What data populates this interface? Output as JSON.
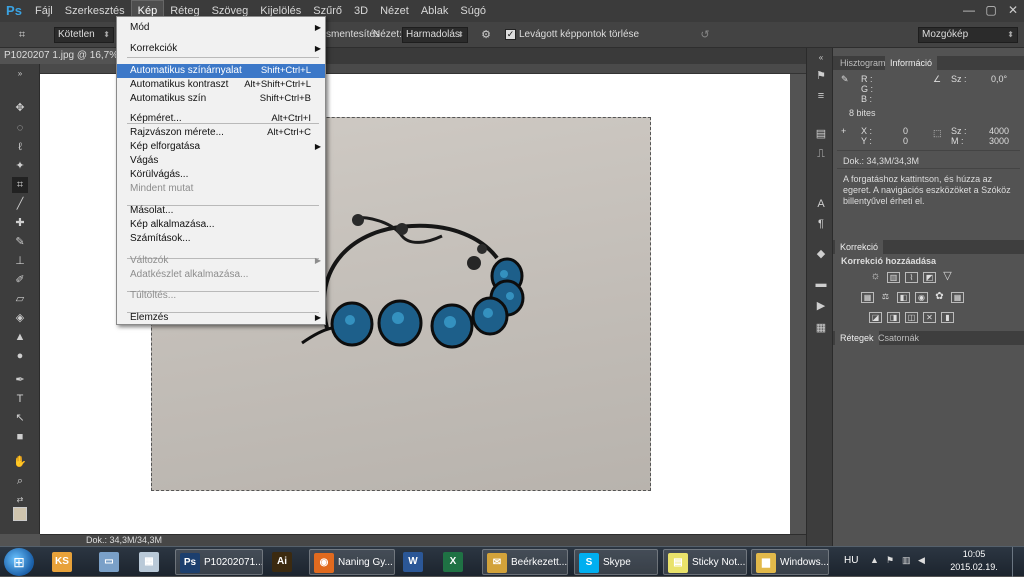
{
  "app": {
    "logo": "Ps"
  },
  "menubar": {
    "items": [
      "Fájl",
      "Szerkesztés",
      "Kép",
      "Réteg",
      "Szöveg",
      "Kijelölés",
      "Szűrő",
      "3D",
      "Nézet",
      "Ablak",
      "Súgó"
    ],
    "active": "Kép"
  },
  "window_controls": [
    "—",
    "▢",
    "✕"
  ],
  "options_bar": {
    "preset": "Kötetlen",
    "partial_label": "smentesítés",
    "view_label": "Nézet:",
    "view_value": "Harmadolás",
    "delete_cropped_label": "Levágott képpontok törlése",
    "delete_cropped_checked": true,
    "workspace": "Mozgókép"
  },
  "document": {
    "tab_title": "P1020207 1.jpg @ 16,7% (RG",
    "status": "Dok.: 34,3M/34,3M"
  },
  "image_menu": {
    "items": [
      {
        "label": "Mód",
        "shortcut": "",
        "submenu": true,
        "disabled": false,
        "highlight": false
      },
      {
        "label": "Korrekciók",
        "shortcut": "",
        "submenu": true,
        "disabled": false,
        "highlight": false
      },
      {
        "label": "Automatikus színárnyalat",
        "shortcut": "Shift+Ctrl+L",
        "submenu": false,
        "disabled": false,
        "highlight": true
      },
      {
        "label": "Automatikus kontraszt",
        "shortcut": "Alt+Shift+Ctrl+L",
        "submenu": false,
        "disabled": false,
        "highlight": false
      },
      {
        "label": "Automatikus szín",
        "shortcut": "Shift+Ctrl+B",
        "submenu": false,
        "disabled": false,
        "highlight": false
      },
      {
        "label": "Képméret...",
        "shortcut": "Alt+Ctrl+I",
        "submenu": false,
        "disabled": false,
        "highlight": false
      },
      {
        "label": "Rajzvászon mérete...",
        "shortcut": "Alt+Ctrl+C",
        "submenu": false,
        "disabled": false,
        "highlight": false
      },
      {
        "label": "Kép elforgatása",
        "shortcut": "",
        "submenu": true,
        "disabled": false,
        "highlight": false
      },
      {
        "label": "Vágás",
        "shortcut": "",
        "submenu": false,
        "disabled": false,
        "highlight": false
      },
      {
        "label": "Körülvágás...",
        "shortcut": "",
        "submenu": false,
        "disabled": false,
        "highlight": false
      },
      {
        "label": "Mindent mutat",
        "shortcut": "",
        "submenu": false,
        "disabled": true,
        "highlight": false
      },
      {
        "label": "Másolat...",
        "shortcut": "",
        "submenu": false,
        "disabled": false,
        "highlight": false
      },
      {
        "label": "Kép alkalmazása...",
        "shortcut": "",
        "submenu": false,
        "disabled": false,
        "highlight": false
      },
      {
        "label": "Számítások...",
        "shortcut": "",
        "submenu": false,
        "disabled": false,
        "highlight": false
      },
      {
        "label": "Változók",
        "shortcut": "",
        "submenu": true,
        "disabled": true,
        "highlight": false
      },
      {
        "label": "Adatkészlet alkalmazása...",
        "shortcut": "",
        "submenu": false,
        "disabled": true,
        "highlight": false
      },
      {
        "label": "Túltöltés...",
        "shortcut": "",
        "submenu": false,
        "disabled": true,
        "highlight": false
      },
      {
        "label": "Elemzés",
        "shortcut": "",
        "submenu": true,
        "disabled": false,
        "highlight": false
      }
    ]
  },
  "panels": {
    "top_tabs": [
      "Hisztogram",
      "Információ"
    ],
    "info": {
      "r": "R :",
      "g": "G :",
      "b": "B :",
      "bits": "8 bites",
      "x": "X :",
      "y": "Y :",
      "x_val": "0",
      "y_val": "0",
      "angle_label": "Sz :",
      "angle_val": "0,0°",
      "w_label": "Sz :",
      "h_label": "M :",
      "w_val": "4000",
      "h_val": "3000",
      "doc": "Dok.: 34,3M/34,3M",
      "hint": "A forgatáshoz kattintson, és húzza az egeret. A navigációs eszközöket a Szóköz billentyűvel érheti el."
    },
    "adjust_tab": "Korrekció",
    "adjust_title": "Korrekció hozzáadása",
    "layers_tabs": [
      "Rétegek",
      "Csatornák"
    ]
  },
  "taskbar": {
    "items": [
      {
        "label": "",
        "icon": "KS",
        "color": "#e8a23a"
      },
      {
        "label": "",
        "icon": "▭",
        "color": "#7aa0c8"
      },
      {
        "label": "",
        "icon": "▦",
        "color": "#b9c9d8"
      },
      {
        "label": "P10202071...",
        "icon": "Ps",
        "color": "#1c3f6e"
      },
      {
        "label": "",
        "icon": "Ai",
        "color": "#3b2a10"
      },
      {
        "label": "Naning Gy...",
        "icon": "◉",
        "color": "#e06a1f"
      },
      {
        "label": "",
        "icon": "W",
        "color": "#2b5797"
      },
      {
        "label": "",
        "icon": "X",
        "color": "#1f7244"
      },
      {
        "label": "Beérkezett...",
        "icon": "✉",
        "color": "#d2a23a"
      },
      {
        "label": "Skype",
        "icon": "S",
        "color": "#00aff0"
      },
      {
        "label": "Sticky Not...",
        "icon": "▤",
        "color": "#e9e26a"
      },
      {
        "label": "Windows...",
        "icon": "▆",
        "color": "#e2b94a"
      }
    ],
    "lang": "HU",
    "time": "10:05",
    "date": "2015.02.19."
  }
}
